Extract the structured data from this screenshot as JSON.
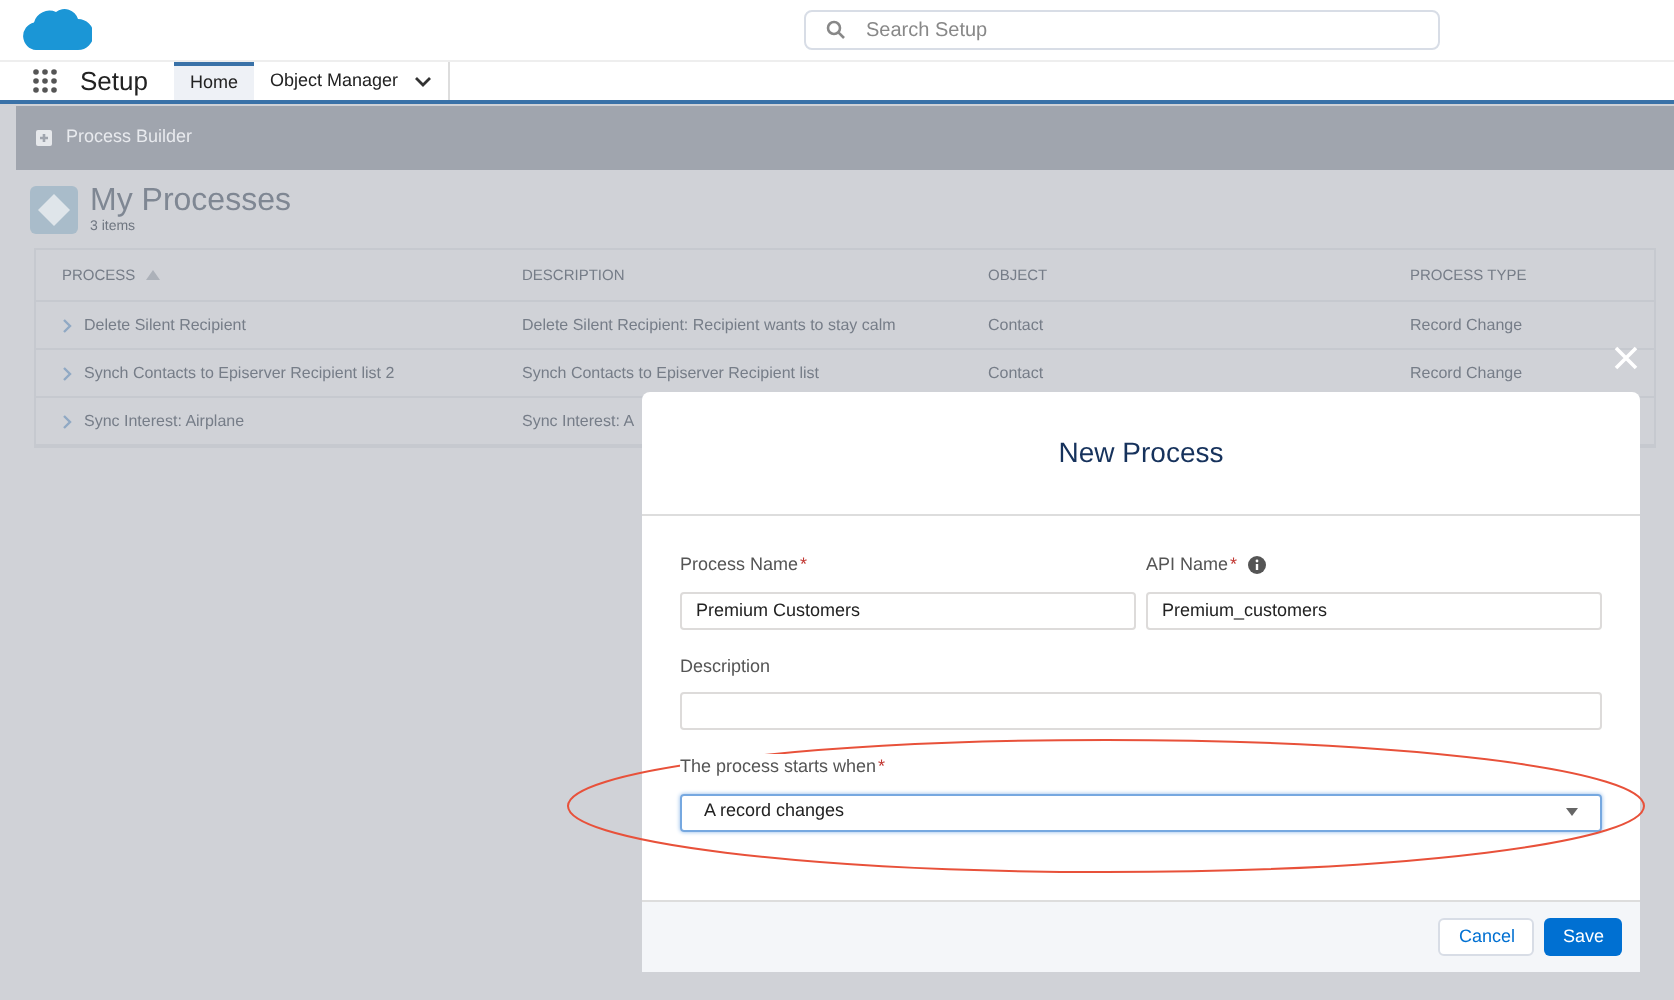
{
  "header": {
    "search": {
      "placeholder": "Search Setup"
    }
  },
  "nav": {
    "app_name": "Setup",
    "tabs": [
      {
        "label": "Home",
        "selected": true
      },
      {
        "label": "Object Manager",
        "selected": false,
        "dropdown": true
      }
    ]
  },
  "page": {
    "breadcrumb": "Process Builder",
    "title": "My Processes",
    "count": "3 items",
    "table": {
      "columns": [
        "PROCESS",
        "DESCRIPTION",
        "OBJECT",
        "PROCESS TYPE"
      ],
      "rows": [
        {
          "cells": [
            "Delete Silent Recipient",
            "Delete Silent Recipient: Recipient wants to stay calm",
            "Contact",
            "Record Change"
          ]
        },
        {
          "cells": [
            "Synch Contacts to Episerver Recipient list 2",
            "Synch Contacts to Episerver Recipient list",
            "Contact",
            "Record Change"
          ]
        },
        {
          "cells": [
            "Sync Interest: Airplane",
            "Sync Interest: A"
          ]
        }
      ]
    }
  },
  "modal": {
    "title": "New Process",
    "fields": [
      {
        "kind": "text",
        "label": "Process Name",
        "required_mark": "*",
        "value": "Premium Customers"
      },
      {
        "kind": "text",
        "label": "API Name",
        "required_mark": "*",
        "info": true,
        "value": "Premium_customers"
      },
      {
        "kind": "text",
        "label": "Description"
      },
      {
        "kind": "select",
        "label": "The process starts when",
        "required_mark": "*",
        "value": "A record changes"
      }
    ],
    "buttons": [
      {
        "label": "Cancel",
        "kind": "neutral"
      },
      {
        "label": "Save",
        "kind": "brand"
      }
    ]
  }
}
